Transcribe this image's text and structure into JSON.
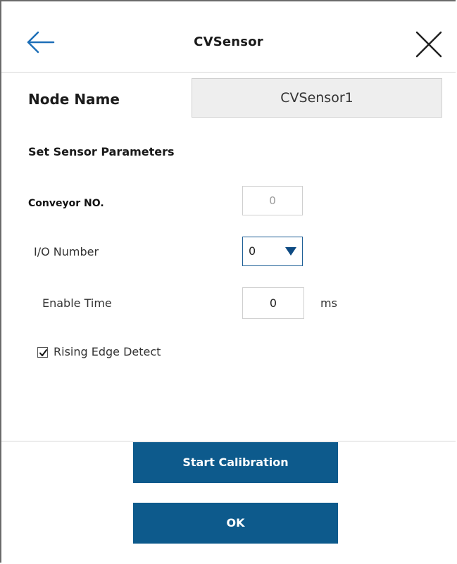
{
  "header": {
    "title": "CVSensor",
    "back_icon": "back-arrow-icon",
    "close_icon": "close-icon",
    "accent_color": "#1e6fb8"
  },
  "node": {
    "label": "Node Name",
    "value": "CVSensor1"
  },
  "sensor_params": {
    "section_title": "Set Sensor Parameters",
    "conveyor_no": {
      "label": "Conveyor NO.",
      "value": "0"
    },
    "io_number": {
      "label": "I/O Number",
      "selected": "0"
    },
    "enable_time": {
      "label": "Enable Time",
      "value": "0",
      "unit": "ms"
    },
    "rising_edge": {
      "label": "Rising Edge Detect",
      "checked": true
    }
  },
  "actions": {
    "start_calibration": "Start Calibration",
    "ok": "OK",
    "button_color": "#0d5a8c"
  }
}
